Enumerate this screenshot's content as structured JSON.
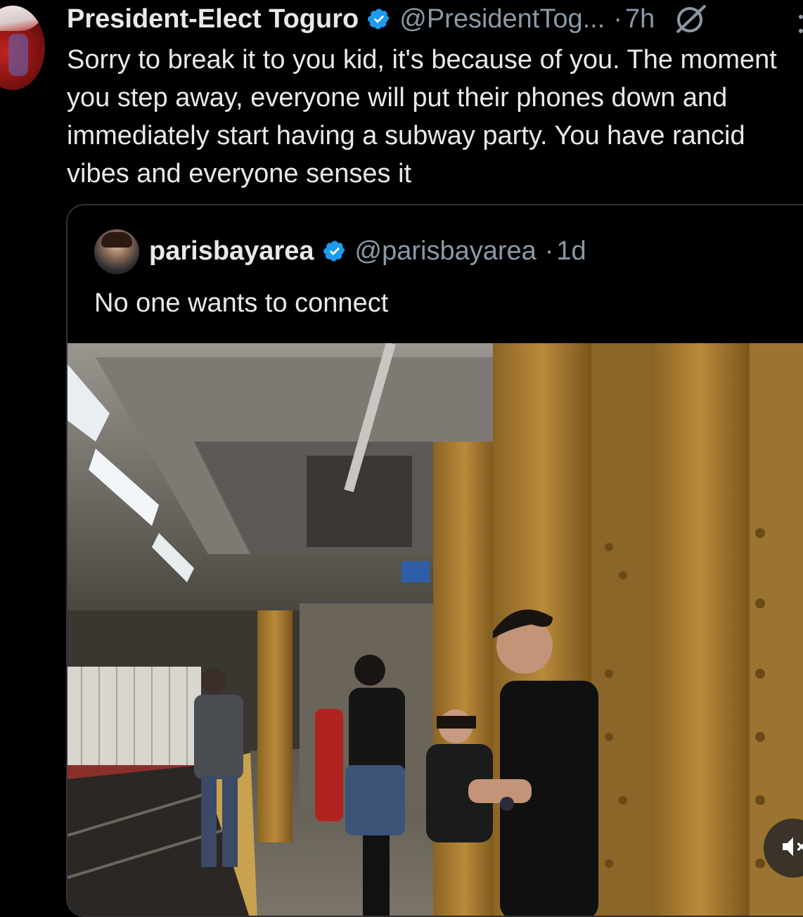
{
  "tweet": {
    "author_name": "President-Elect Toguro",
    "handle": "@PresidentTog...",
    "separator": "·",
    "time": "7h",
    "text": "Sorry to break it to you kid, it's because of you. The moment you step away, everyone will put their phones down and immediately start having a subway party. You have rancid vibes and everyone senses it",
    "verified": true,
    "icons": [
      "verified-badge-icon",
      "grok-icon",
      "more-menu-icon"
    ]
  },
  "quote": {
    "author_name": "parisbayarea",
    "handle": "@parisbayarea",
    "separator": "·",
    "time": "1d",
    "text": "No one wants to connect",
    "verified": true,
    "media_type": "photo",
    "media_description_icon": "subway-platform-photo"
  },
  "controls": {
    "mute_icon": "speaker-muted-icon"
  },
  "colors": {
    "background": "#000000",
    "text": "#e7e9ea",
    "muted": "#8b98a5",
    "verified": "#1d9bf0",
    "border": "#2f3336"
  }
}
